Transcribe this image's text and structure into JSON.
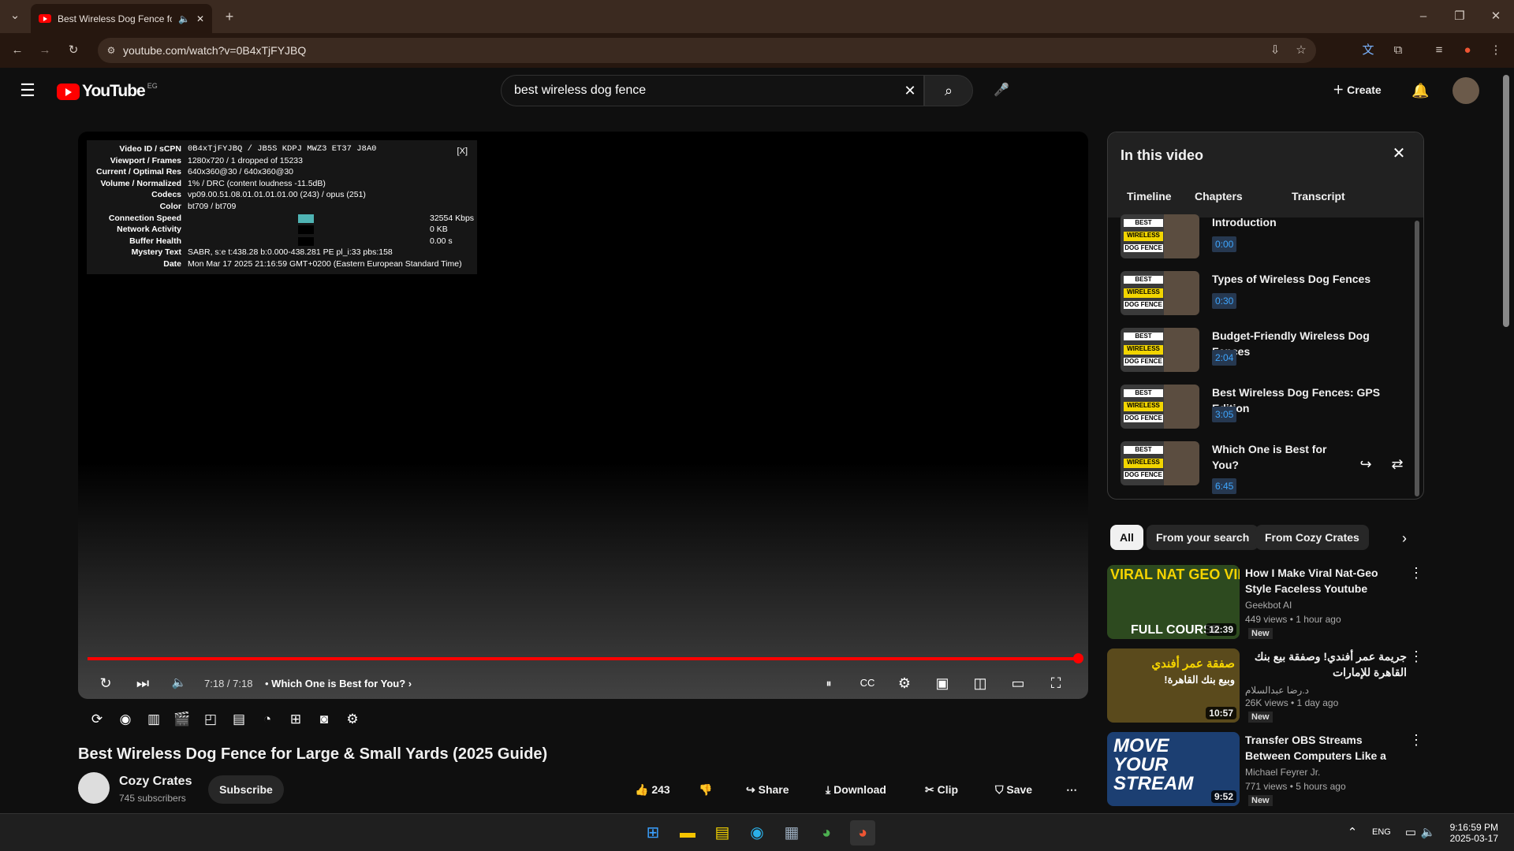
{
  "browser": {
    "tab_title": "Best Wireless Dog Fence for",
    "url": "youtube.com/watch?v=0B4xTjFYJBQ"
  },
  "youtube": {
    "logo": "YouTube",
    "region": "EG",
    "search_value": "best wireless dog fence",
    "create_label": "Create"
  },
  "stats": {
    "close": "[X]",
    "rows": [
      {
        "k": "Video ID / sCPN",
        "v": "0B4xTjFYJBQ / JB5S KDPJ MWZ3 ET37 J8A0"
      },
      {
        "k": "Viewport / Frames",
        "v": "1280x720 / 1 dropped of 15233"
      },
      {
        "k": "Current / Optimal Res",
        "v": "640x360@30 / 640x360@30"
      },
      {
        "k": "Volume / Normalized",
        "v": "1% / DRC (content loudness -11.5dB)"
      },
      {
        "k": "Codecs",
        "v": "vp09.00.51.08.01.01.01.01.00 (243) / opus (251)"
      },
      {
        "k": "Color",
        "v": "bt709 / bt709"
      },
      {
        "k": "Connection Speed",
        "v": "32554 Kbps"
      },
      {
        "k": "Network Activity",
        "v": "0 KB"
      },
      {
        "k": "Buffer Health",
        "v": "0.00 s"
      },
      {
        "k": "Mystery Text",
        "v": "SABR, s:e t:438.28 b:0.000-438.281 PE pl_i:33 pbs:158"
      },
      {
        "k": "Date",
        "v": "Mon Mar 17 2025 21:16:59 GMT+0200 (Eastern European Standard Time)"
      }
    ]
  },
  "player": {
    "time": "7:18 / 7:18",
    "chapter": "Which One is Best for You?",
    "progress": 1.0
  },
  "video": {
    "title": "Best Wireless Dog Fence for Large & Small Yards (2025 Guide)",
    "channel": "Cozy Crates",
    "subscribers": "745 subscribers",
    "subscribe": "Subscribe",
    "likes": "243",
    "share": "Share",
    "download": "Download",
    "clip": "Clip",
    "save": "Save"
  },
  "panel": {
    "title": "In this video",
    "tabs": [
      "Timeline",
      "Chapters",
      "Transcript"
    ],
    "chapters": [
      {
        "title": "Introduction",
        "time": "0:00"
      },
      {
        "title": "Types of Wireless Dog Fences",
        "time": "0:30"
      },
      {
        "title": "Budget-Friendly Wireless Dog Fences",
        "time": "2:04"
      },
      {
        "title": "Best Wireless Dog Fences: GPS Edition",
        "time": "3:05"
      },
      {
        "title": "Which One is Best for You?",
        "time": "6:45"
      }
    ],
    "thumb_text": [
      "BEST",
      "WIRELESS",
      "DOG FENCE"
    ]
  },
  "chips": [
    "All",
    "From your search",
    "From Cozy Crates"
  ],
  "recs": [
    {
      "title": "How I Make Viral Nat-Geo Style Faceless Youtube Automation...",
      "channel": "Geekbot AI",
      "meta": "449 views • 1 hour ago",
      "badge": "New",
      "duration": "12:39",
      "thumb_text": "VIRAL NAT GEO VIDEOS",
      "thumb_sub": "FULL COURSE",
      "color": "#2d4a1f"
    },
    {
      "title": "جريمة عمر أفندي! وصفقة بيع بنك القاهرة للإمارات",
      "channel": "د.رضا عبدالسلام",
      "meta": "26K views • 1 day ago",
      "badge": "New",
      "duration": "10:57",
      "thumb_text": "صفقة عمر أفندي",
      "thumb_sub": "وبيع بنك القاهرة!",
      "color": "#5a4a1c"
    },
    {
      "title": "Transfer OBS Streams Between Computers Like a Pro!",
      "channel": "Michael Feyrer Jr.",
      "meta": "771 views • 5 hours ago",
      "badge": "New",
      "duration": "9:52",
      "thumb_text": "MOVE YOUR STREAM",
      "thumb_sub": "",
      "color": "#1c3f72"
    }
  ],
  "taskbar": {
    "lang": "ENG",
    "time": "9:16:59 PM",
    "date": "2025-03-17"
  }
}
